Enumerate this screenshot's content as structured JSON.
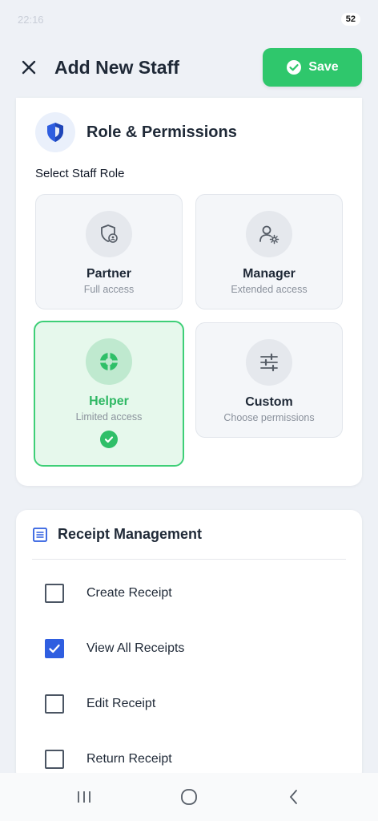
{
  "status_bar": {
    "time": "22:16",
    "battery": "52"
  },
  "header": {
    "title": "Add New Staff",
    "save_label": "Save"
  },
  "roles_section": {
    "title": "Role & Permissions",
    "select_label": "Select Staff Role",
    "roles": [
      {
        "name": "Partner",
        "desc": "Full access",
        "icon": "shield-user-icon",
        "selected": false
      },
      {
        "name": "Manager",
        "desc": "Extended access",
        "icon": "user-gear-icon",
        "selected": false
      },
      {
        "name": "Helper",
        "desc": "Limited access",
        "icon": "lifebuoy-icon",
        "selected": true
      },
      {
        "name": "Custom",
        "desc": "Choose permissions",
        "icon": "sliders-icon",
        "selected": false
      }
    ]
  },
  "receipt_section": {
    "title": "Receipt Management",
    "permissions": [
      {
        "label": "Create Receipt",
        "checked": false
      },
      {
        "label": "View All Receipts",
        "checked": true
      },
      {
        "label": "Edit Receipt",
        "checked": false
      },
      {
        "label": "Return Receipt",
        "checked": false
      }
    ]
  },
  "colors": {
    "accent_green": "#2fc76c",
    "checkbox_blue": "#2f5ee0",
    "icon_blue": "#2f5ee0"
  }
}
